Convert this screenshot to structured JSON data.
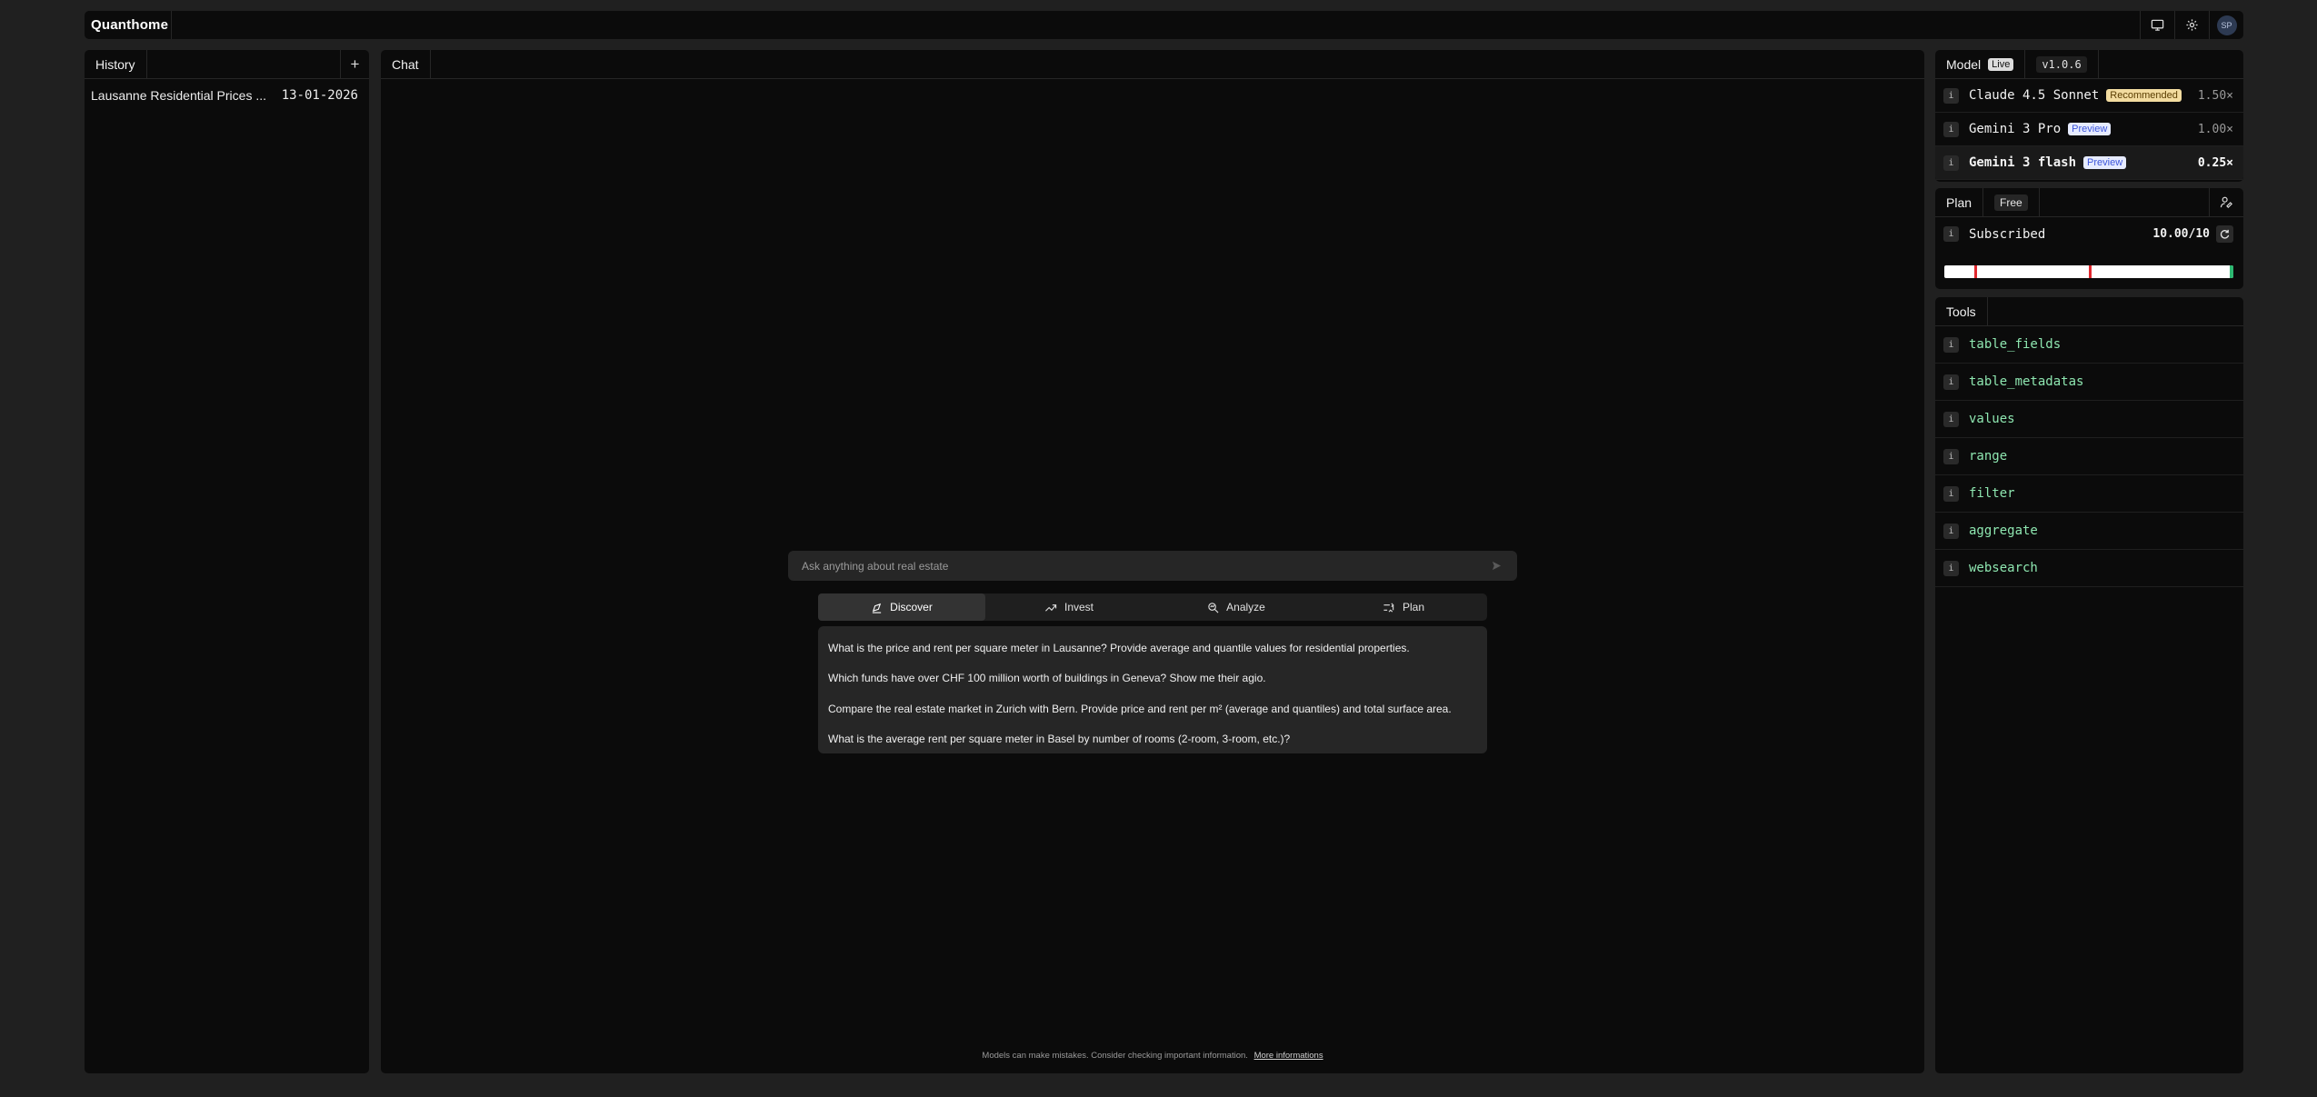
{
  "app": {
    "logo": "Quanthome",
    "avatar_initials": "SP"
  },
  "history": {
    "tab_label": "History",
    "new_label": "+",
    "items": [
      {
        "title": "Lausanne Residential Prices ...",
        "date": "13-01-2026"
      }
    ]
  },
  "chat": {
    "tab_label": "Chat",
    "input_placeholder": "Ask anything about real estate",
    "modes": [
      {
        "label": "Discover",
        "icon": "discover-icon",
        "active": true
      },
      {
        "label": "Invest",
        "icon": "trend-up-icon"
      },
      {
        "label": "Analyze",
        "icon": "analyze-icon"
      },
      {
        "label": "Plan",
        "icon": "plan-icon"
      }
    ],
    "suggestions": [
      "What is the price and rent per square meter in Lausanne? Provide average and quantile values for residential properties.",
      "Which funds have over CHF 100 million worth of buildings in Geneva? Show me their agio.",
      "Compare the real estate market in Zurich with Bern. Provide price and rent per m² (average and quantiles) and total surface area.",
      "What is the average rent per square meter in Basel by number of rooms (2-room, 3-room, etc.)?"
    ],
    "footer_text": "Models can make mistakes. Consider checking important information.",
    "footer_link": "More informations"
  },
  "model_panel": {
    "tab_label": "Model",
    "live_badge": "Live",
    "version": "v1.0.6",
    "info_glyph": "i",
    "models": [
      {
        "name": "Claude 4.5 Sonnet",
        "tag": "Recommended",
        "tag_type": "recommended",
        "multiplier": "1.50×"
      },
      {
        "name": "Gemini 3 Pro",
        "tag": "Preview",
        "tag_type": "preview",
        "multiplier": "1.00×"
      },
      {
        "name": "Gemini 3 flash",
        "tag": "Preview",
        "tag_type": "preview",
        "multiplier": "0.25×",
        "selected": true
      }
    ]
  },
  "plan_panel": {
    "tab_label": "Plan",
    "plan_badge": "Free",
    "status_label": "Subscribed",
    "usage": "10.00/10",
    "usage_fraction": 1.0,
    "colors": {
      "track": "#ffffff",
      "marker": "#e0282e",
      "end": "#2eb872"
    }
  },
  "tools_panel": {
    "tab_label": "Tools",
    "tools": [
      "table_fields",
      "table_metadatas",
      "values",
      "range",
      "filter",
      "aggregate",
      "websearch"
    ]
  },
  "colors": {
    "background": "#202020",
    "panel": "#0b0b0b",
    "tool_text": "#8ee6b0",
    "recommended_bg": "#f3dca0",
    "preview_text": "#3c55d9"
  }
}
